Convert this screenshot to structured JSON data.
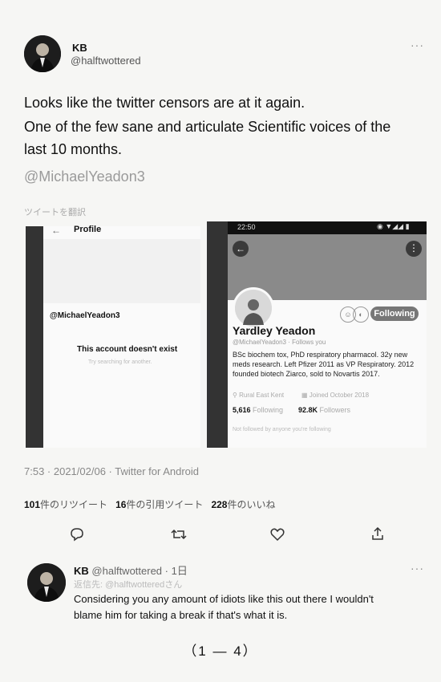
{
  "tweet": {
    "author_name": "KB",
    "author_handle": "@halftwottered",
    "text_line1": "Looks like the twitter censors are at it again.",
    "text_line2": "One of the few sane and articulate Scientific voices of the",
    "text_line3": "last 10 months.",
    "mention": "@MichaelYeadon3",
    "translate": "ツイートを翻訳",
    "time": "7:53 · 2021/02/06 · Twitter for Android",
    "stats": {
      "retweets_num": "101",
      "retweets_label": "件のリツイート",
      "quotes_num": "16",
      "quotes_label": "件の引用ツイート",
      "likes_num": "228",
      "likes_label": "件のいいね"
    },
    "actions": [
      "reply-icon",
      "retweet-icon",
      "like-icon",
      "share-icon"
    ]
  },
  "screenshot_left": {
    "back": "←",
    "header": "Profile",
    "handle": "@MichaelYeadon3",
    "message": "This account doesn't exist",
    "sub": "Try searching for another."
  },
  "screenshot_right": {
    "status_time": "22:50",
    "name": "Yardley Yeadon",
    "handle": "@MichaelYeadon3 · Follows you",
    "follow_label": "Following",
    "bio": "BSc biochem tox, PhD respiratory pharmacol. 32y new meds research. Left Pfizer 2011 as VP Respiratory. 2012 founded biotech Ziarco, sold to Novartis 2017.",
    "location": "Rural East Kent",
    "joined": "Joined October 2018",
    "following_num": "5,616",
    "following_label": "Following",
    "followers_num": "92.8K",
    "followers_label": "Followers",
    "followed_by": "Not followed by anyone you're following"
  },
  "reply": {
    "author_name": "KB",
    "author_handle": "@halftwottered · 1日",
    "replying_to": "返信先: @halftwotteredさん",
    "text_line1": "Considering you any amount of idiots like this out there I wouldn't",
    "text_line2": "blame him for taking a break if that's what it is."
  },
  "page_number": "（1 ― 4）",
  "colors": {
    "text": "#111111",
    "muted": "#999999",
    "dark_bar": "#333333"
  }
}
